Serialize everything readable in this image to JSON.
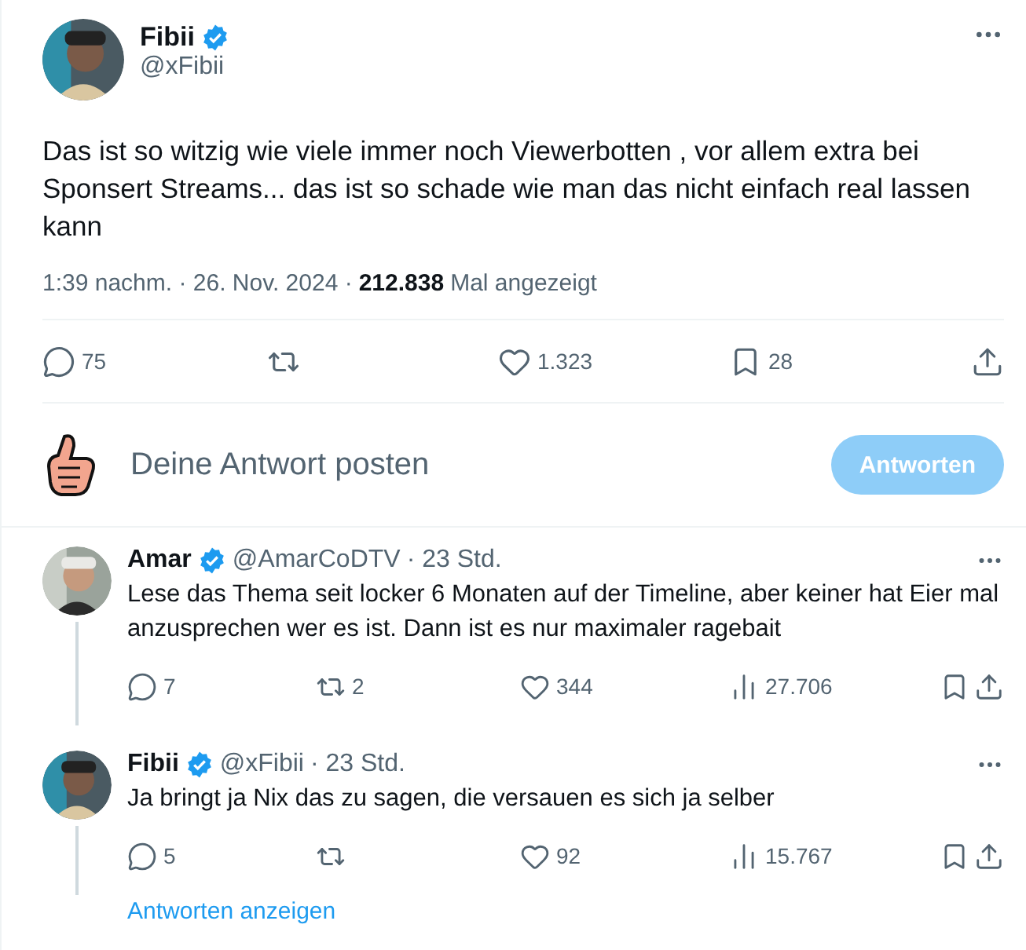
{
  "tweet": {
    "author": {
      "name": "Fibii",
      "verified": true,
      "handle": "@xFibii"
    },
    "text": "Das ist so witzig wie viele immer noch Viewerbotten , vor allem extra bei Sponsert Streams... das ist so schade wie man das nicht einfach real lassen kann",
    "time": "1:39 nachm. · 26. Nov. 2024 ·",
    "views": "212.838",
    "views_label": "Mal angezeigt",
    "actions": [
      {
        "kind": "reply",
        "count": "75"
      },
      {
        "kind": "retweet"
      },
      {
        "kind": "like",
        "count": "1.323"
      },
      {
        "kind": "bookmark",
        "count": "28"
      },
      {
        "kind": "share"
      }
    ]
  },
  "composer": {
    "placeholder": "Deine Antwort posten",
    "button": {
      "label": "Antworten",
      "disabled": true
    }
  },
  "replies": [
    {
      "name": "Amar",
      "verified": true,
      "handle": "@AmarCoDTV",
      "time": "· 23 Std.",
      "text": "Lese das Thema seit locker 6 Monaten auf der Timeline, aber keiner hat Eier mal anzusprechen wer es ist. Dann ist es nur maximaler ragebait",
      "actions": [
        {
          "kind": "reply",
          "count": "7"
        },
        {
          "kind": "retweet",
          "count": "2"
        },
        {
          "kind": "like",
          "count": "344"
        },
        {
          "kind": "views",
          "count": "27.706"
        },
        {
          "kind": "bookmark"
        },
        {
          "kind": "share"
        }
      ]
    },
    {
      "name": "Fibii",
      "verified": true,
      "handle": "@xFibii",
      "time": "· 23 Std.",
      "text": "Ja bringt ja Nix das zu sagen, die versauen es sich ja selber",
      "actions": [
        {
          "kind": "reply",
          "count": "5"
        },
        {
          "kind": "retweet"
        },
        {
          "kind": "like",
          "count": "92"
        },
        {
          "kind": "views",
          "count": "15.767"
        },
        {
          "kind": "bookmark"
        },
        {
          "kind": "share"
        }
      ]
    }
  ],
  "show_replies": "Antworten anzeigen"
}
